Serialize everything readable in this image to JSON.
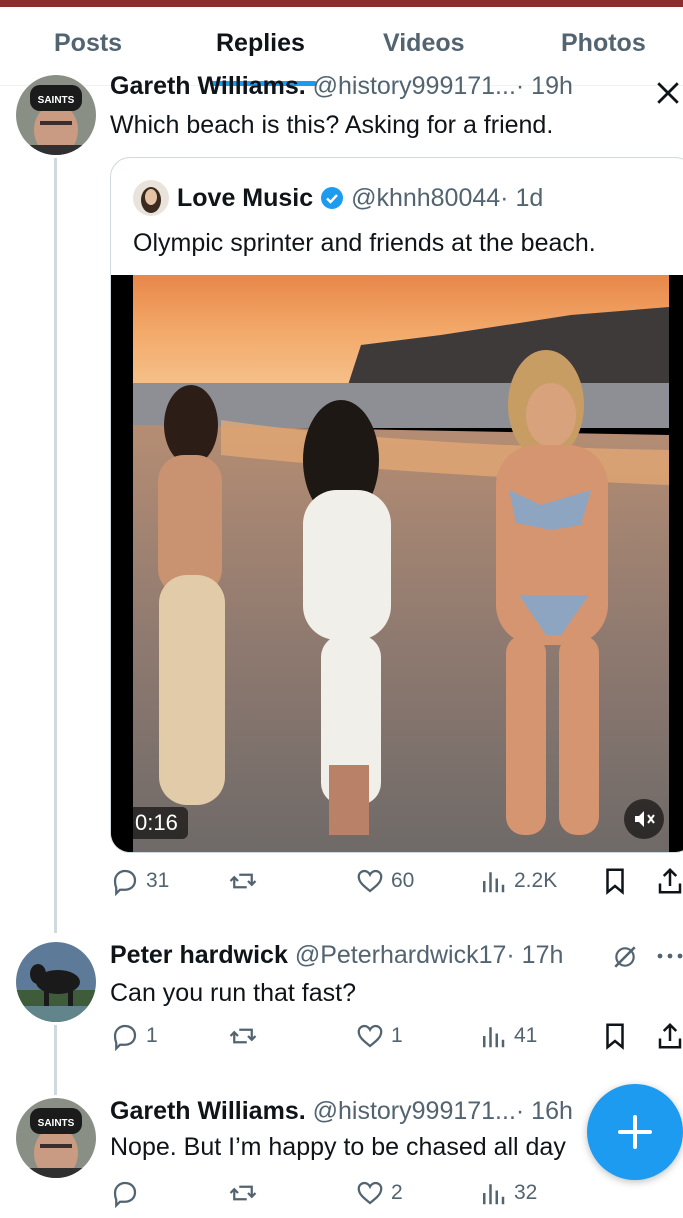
{
  "tabs": [
    {
      "label": "Posts"
    },
    {
      "label": "Replies"
    },
    {
      "label": "Videos"
    },
    {
      "label": "Photos"
    }
  ],
  "tweet1": {
    "name": "Gareth Williams.",
    "handle": "@history999171...",
    "time": "· 19h",
    "text": "Which beach is this?  Asking for a friend.",
    "avatar_text": "SAINTS",
    "quote": {
      "name": "Love Music",
      "handle": "@khnh80044",
      "time": "· 1d",
      "text": "Olympic sprinter and friends at the beach.",
      "video_time": "0:16"
    },
    "stats": {
      "replies": "31",
      "likes": "60",
      "views": "2.2K"
    }
  },
  "tweet2": {
    "name": "Peter hardwick",
    "handle": "@Peterhardwick17",
    "time": "· 17h",
    "text": "Can you run that fast?",
    "stats": {
      "replies": "1",
      "likes": "1",
      "views": "41"
    }
  },
  "tweet3": {
    "name": "Gareth Williams.",
    "handle": "@history999171...",
    "time": "· 16h",
    "text": "Nope. But I’m happy to be chased all day",
    "avatar_text": "SAINTS",
    "stats": {
      "likes": "2",
      "views": "32"
    }
  },
  "colors": {
    "accent": "#1d9bf0",
    "text": "#0f1419",
    "muted": "#536471",
    "top_bar": "#8b2d2d"
  }
}
